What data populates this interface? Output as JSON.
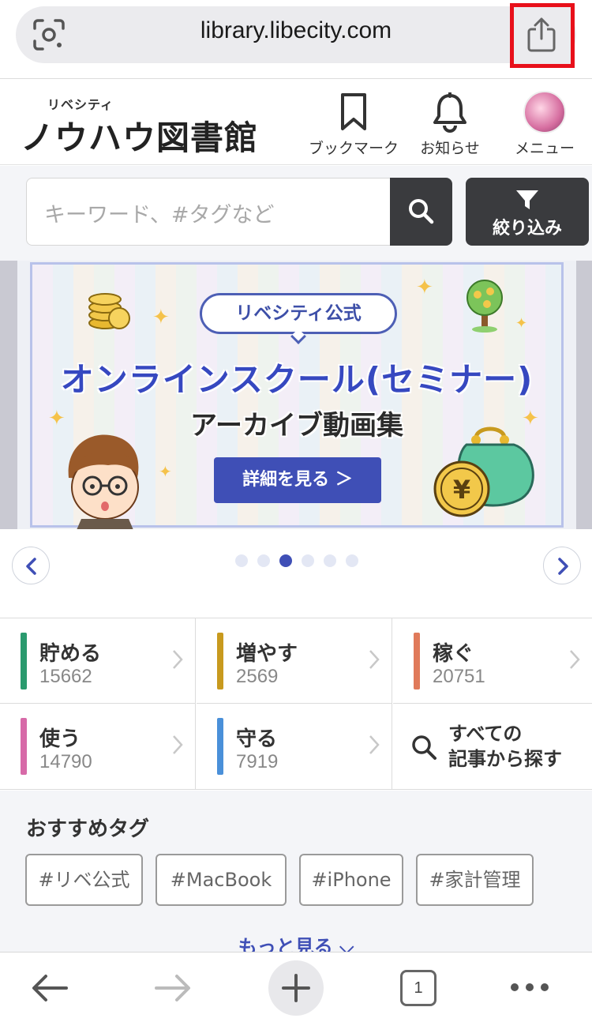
{
  "browser": {
    "url": "library.libecity.com",
    "lens_icon": "google-lens-icon",
    "share_icon": "share-icon"
  },
  "header": {
    "logo_small": "リベシティ",
    "logo_main": "ノウハウ図書館",
    "bookmark_label": "ブックマーク",
    "notify_label": "お知らせ",
    "menu_label": "メニュー"
  },
  "search": {
    "placeholder": "キーワード、#タグなど",
    "filter_label": "絞り込み"
  },
  "banner": {
    "badge": "リベシティ公式",
    "title": "オンラインスクール(セミナー)",
    "subtitle": "アーカイブ動画集",
    "button": "詳細を見る ＞"
  },
  "carousel": {
    "dot_count": 6,
    "active_index": 2
  },
  "categories": [
    {
      "name": "貯める",
      "count": "15662",
      "color": "#2a9a6e"
    },
    {
      "name": "増やす",
      "count": "2569",
      "color": "#c89a1e"
    },
    {
      "name": "稼ぐ",
      "count": "20751",
      "color": "#e07a5a"
    },
    {
      "name": "使う",
      "count": "14790",
      "color": "#d76aa8"
    },
    {
      "name": "守る",
      "count": "7919",
      "color": "#4a90d9"
    }
  ],
  "search_all": {
    "line1": "すべての",
    "line2": "記事から探す"
  },
  "tags": {
    "title": "おすすめタグ",
    "items": [
      "#リベ公式",
      "#MacBook",
      "#iPhone",
      "#家計管理"
    ],
    "more": "もっと見る ⌵"
  },
  "toolbar": {
    "tab_count": "1"
  }
}
